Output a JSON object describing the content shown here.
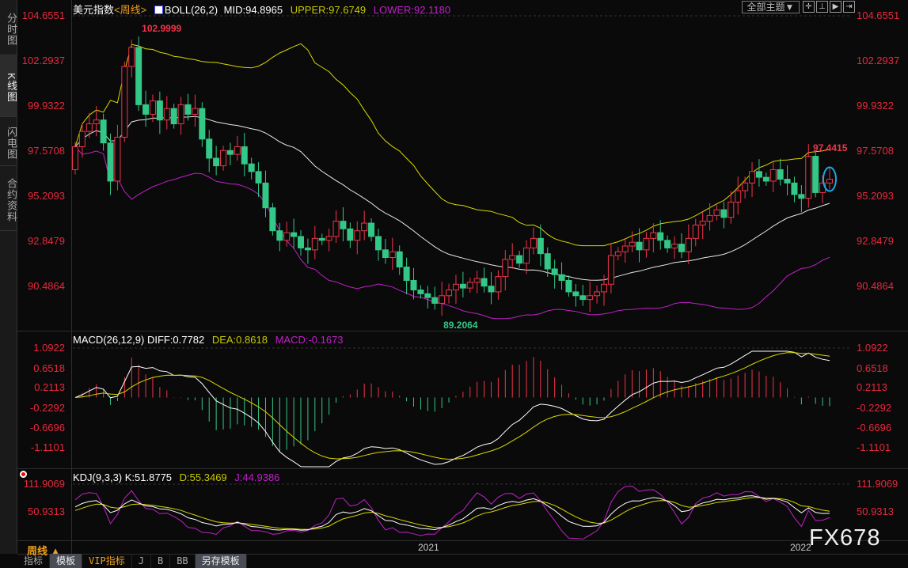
{
  "sidebar": {
    "tabs": [
      {
        "label": "分时图"
      },
      {
        "label": "K线图"
      },
      {
        "label": "闪电图"
      },
      {
        "label": "合约资料"
      }
    ]
  },
  "header": {
    "instrument": "美元指数",
    "period": "<周线>",
    "boll_label": "BOLL(26,2)",
    "mid": "MID:94.8965",
    "upper": "UPPER:97.6749",
    "lower": "LOWER:92.1180"
  },
  "toolbar": {
    "theme": "全部主题▼",
    "icons": [
      "crosshair-icon",
      "zoom-in-icon",
      "play-icon",
      "move-right-icon"
    ]
  },
  "macd_header": {
    "label": "MACD(26,12,9)",
    "diff": "DIFF:0.7782",
    "dea": "DEA:0.8618",
    "macd": "MACD:-0.1673"
  },
  "kdj_header": {
    "label": "KDJ(9,3,3)",
    "k": "K:51.8775",
    "d": "D:55.3469",
    "j": "J:44.9386"
  },
  "annotations": {
    "high": "102.9999",
    "low": "89.2064",
    "last_high": "97.4415"
  },
  "period_selector": "周线 ▲",
  "bottom_tabs": [
    "指标",
    "模板",
    "VIP指标",
    "J",
    "B",
    "BB",
    "另存模板"
  ],
  "watermark": "FX678",
  "colors": {
    "up": "#f0344a",
    "down": "#33c887",
    "mid": "#e8e8e8",
    "upper": "#d8d800",
    "lower": "#c020c8",
    "axis": "#e8283c"
  },
  "chart_data": {
    "type": "candlestick",
    "title": "美元指数 周线",
    "price_ticks": [
      "104.6551",
      "102.2937",
      "99.9322",
      "97.5708",
      "95.2093",
      "92.8479",
      "90.4864"
    ],
    "price_range": [
      90.4864,
      104.6551
    ],
    "macd_ticks": [
      "1.0922",
      "0.6518",
      "0.2113",
      "-0.2292",
      "-0.6696",
      "-1.1101"
    ],
    "kdj_ticks": [
      "111.9069",
      "50.9313"
    ],
    "x_labels": [
      "2021",
      "2022"
    ],
    "closes": [
      97.8,
      98.6,
      99.0,
      99.2,
      98.0,
      96.0,
      98.3,
      102.0,
      103.0,
      100.0,
      99.5,
      100.2,
      99.2,
      99.8,
      99.0,
      100.0,
      99.5,
      99.8,
      98.2,
      97.2,
      96.8,
      97.6,
      97.4,
      97.8,
      96.9,
      96.5,
      95.9,
      94.6,
      93.4,
      92.9,
      93.3,
      93.1,
      92.5,
      92.4,
      93.0,
      92.9,
      93.1,
      93.9,
      93.5,
      92.9,
      93.4,
      93.8,
      93.1,
      92.4,
      92.0,
      92.3,
      91.5,
      90.8,
      90.3,
      90.1,
      89.9,
      89.6,
      90.0,
      90.3,
      90.6,
      90.4,
      90.7,
      90.9,
      90.5,
      90.2,
      91.0,
      91.9,
      92.1,
      91.7,
      92.5,
      93.0,
      92.2,
      91.4,
      91.1,
      90.8,
      90.2,
      90.0,
      89.8,
      90.0,
      90.2,
      90.6,
      92.1,
      92.3,
      92.6,
      92.8,
      92.4,
      93.0,
      93.3,
      92.9,
      92.5,
      92.7,
      92.3,
      93.0,
      93.7,
      93.9,
      94.2,
      94.5,
      94.1,
      94.9,
      95.5,
      95.9,
      96.5,
      96.2,
      96.0,
      96.6,
      96.1,
      95.9,
      95.3,
      95.1,
      97.3,
      95.4,
      95.9,
      96.1
    ],
    "first_open": 96.6
  }
}
